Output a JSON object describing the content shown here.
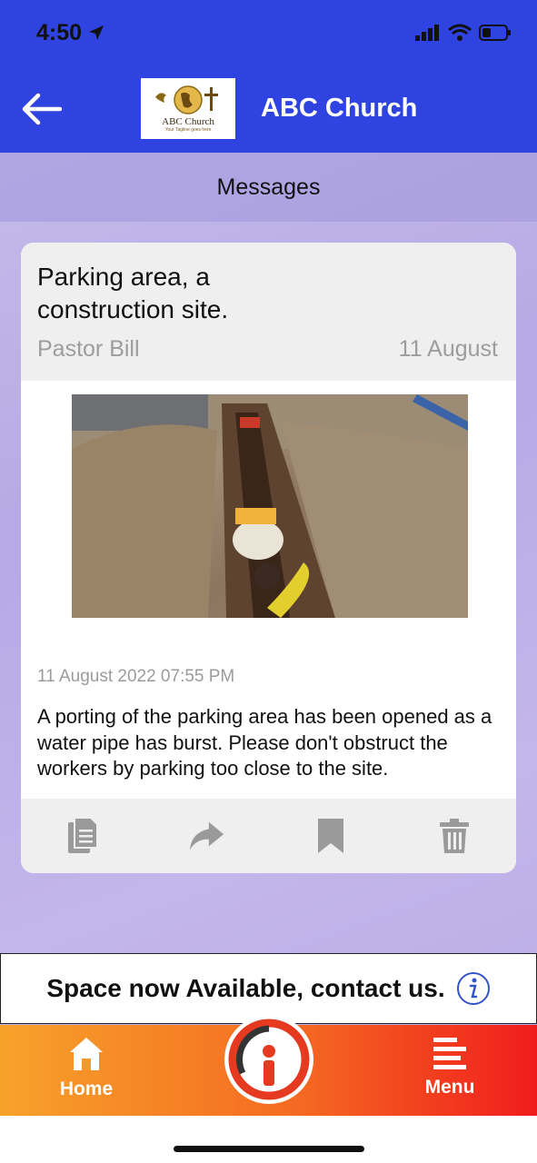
{
  "status_bar": {
    "time": "4:50"
  },
  "header": {
    "title": "ABC Church",
    "logo_name": "ABC Church",
    "logo_tagline": "Your Tagline goes here"
  },
  "sub_header": {
    "title": "Messages"
  },
  "message": {
    "title": "Parking area, a construction site.",
    "author": "Pastor Bill",
    "date": "11 August",
    "timestamp": "11 August 2022 07:55 PM",
    "body": "A porting of the parking area has been opened as a water pipe has burst. Please don't obstruct the workers by parking too close to the site.",
    "actions": [
      "copy-icon",
      "share-icon",
      "bookmark-icon",
      "trash-icon"
    ]
  },
  "banner": {
    "text": "Space now Available, contact us."
  },
  "tabbar": {
    "home_label": "Home",
    "menu_label": "Menu"
  },
  "colors": {
    "header": "#2f43e0",
    "tabbar_start": "#f7a22a",
    "tabbar_end": "#f01c1c",
    "icon_gray": "#9a9a9a"
  }
}
